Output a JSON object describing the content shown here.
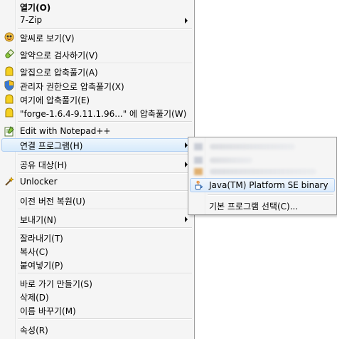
{
  "menu": {
    "open": "열기(O)",
    "sevenzip": "7-Zip",
    "alzip_view": "알씨로 보기(V)",
    "alyac_scan": "알약으로 검사하기(V)",
    "alzip_extract": "알집으로 압축풀기(A)",
    "admin_extract": "관리자 권한으로 압축풀기(X)",
    "extract_here": "여기에 압축풀기(E)",
    "extract_to_folder": "\"forge-1.6.4-9.11.1.96...\" 에 압축풀기(W)",
    "edit_notepad": "Edit with Notepad++",
    "open_with": "연결 프로그램(H)",
    "share_with": "공유 대상(H)",
    "unlocker": "Unlocker",
    "restore_previous": "이전 버전 복원(U)",
    "send_to": "보내기(N)",
    "cut": "잘라내기(T)",
    "copy": "복사(C)",
    "paste": "붙여넣기(P)",
    "create_shortcut": "바로 가기 만들기(S)",
    "delete": "삭제(D)",
    "rename": "이름 바꾸기(M)",
    "properties": "속성(R)"
  },
  "submenu": {
    "java": "Java(TM) Platform SE binary",
    "choose_default": "기본 프로그램 선택(C)..."
  },
  "colors": {
    "menu_bg": "#f5f5f5",
    "highlight_border": "#aecdf2",
    "highlight_fill": "#d6eafb"
  }
}
